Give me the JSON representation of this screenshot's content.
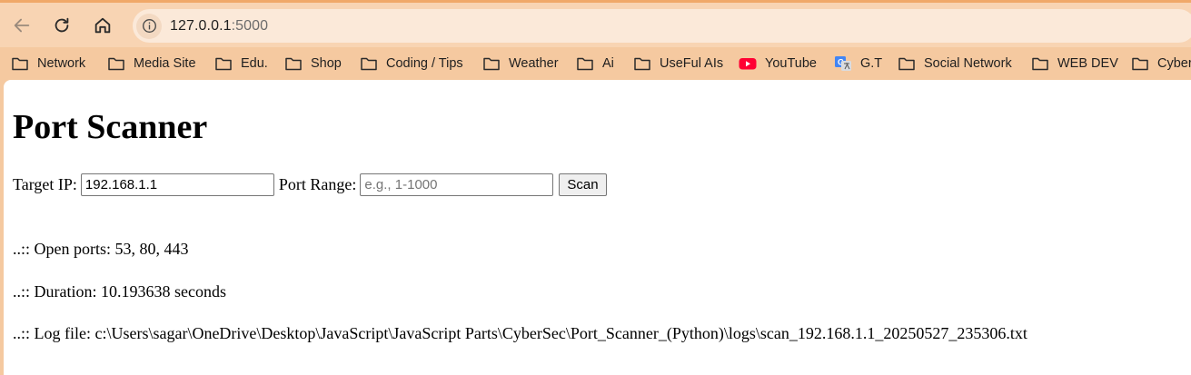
{
  "browser": {
    "url_host": "127.0.0.1",
    "url_port": ":5000",
    "bookmarks": [
      {
        "label": "Network",
        "icon": "folder-icon"
      },
      {
        "label": "Media Site",
        "icon": "folder-icon"
      },
      {
        "label": "Edu.",
        "icon": "folder-icon"
      },
      {
        "label": "Shop",
        "icon": "folder-icon"
      },
      {
        "label": "Coding / Tips",
        "icon": "folder-icon"
      },
      {
        "label": "Weather",
        "icon": "folder-icon"
      },
      {
        "label": "Ai",
        "icon": "folder-icon"
      },
      {
        "label": "UseFul AIs",
        "icon": "folder-icon"
      },
      {
        "label": "YouTube",
        "icon": "youtube-icon"
      },
      {
        "label": "G.T",
        "icon": "google-translate-icon"
      },
      {
        "label": "Social Network",
        "icon": "folder-icon"
      },
      {
        "label": "WEB DEV",
        "icon": "folder-icon"
      },
      {
        "label": "Cyber",
        "icon": "folder-icon"
      }
    ],
    "colors": {
      "toolbar": "#f8d4b3",
      "bookmark_bar": "#f5c9a0",
      "youtube_red": "#ff0033"
    }
  },
  "page": {
    "title": "Port Scanner",
    "form": {
      "target_ip_label": "Target IP:",
      "target_ip_value": "192.168.1.1",
      "port_range_label": "Port Range:",
      "port_range_placeholder": "e.g., 1-1000",
      "scan_label": "Scan"
    },
    "results": {
      "open_ports": "..:: Open ports: 53, 80, 443",
      "duration": "..:: Duration: 10.193638 seconds",
      "log_file": "..:: Log file: c:\\Users\\sagar\\OneDrive\\Desktop\\JavaScript\\JavaScript Parts\\CyberSec\\Port_Scanner_(Python)\\logs\\scan_192.168.1.1_20250527_235306.txt"
    }
  }
}
